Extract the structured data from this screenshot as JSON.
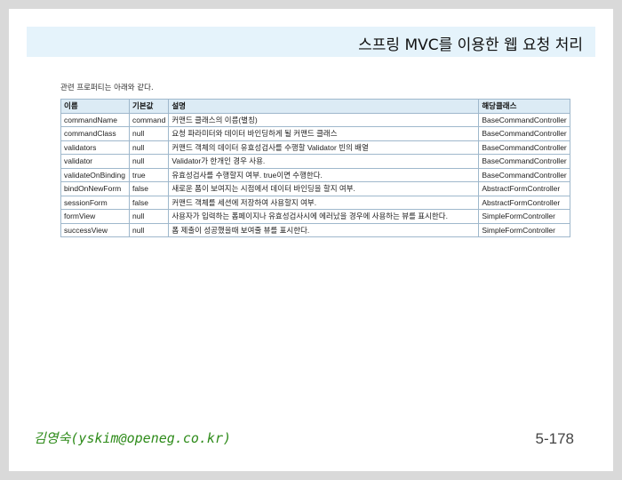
{
  "slide_title": "스프링 MVC를 이용한 웹 요청 처리",
  "intro_text": "관련 프로퍼티는 아래와 같다.",
  "table": {
    "headers": {
      "name": "이름",
      "default": "기본값",
      "desc": "설명",
      "class": "해당클래스"
    },
    "rows": [
      {
        "name": "commandName",
        "default": "command",
        "desc": "커맨드 클래스의 이름(별칭)",
        "class": "BaseCommandController"
      },
      {
        "name": "commandClass",
        "default": "null",
        "desc": "요청 파라미터와 데이터 바인딩하게 될 커맨드 클래스",
        "class": "BaseCommandController"
      },
      {
        "name": "validators",
        "default": "null",
        "desc": "커맨드 객체의 데이터 유효성검사를 수행할 Validator 빈의 배열",
        "class": "BaseCommandController"
      },
      {
        "name": "validator",
        "default": "null",
        "desc": "Validator가 한개인 경우 사용.",
        "class": "BaseCommandController"
      },
      {
        "name": "validateOnBinding",
        "default": "true",
        "desc": "유효성검사를 수행할지 여부. true이면 수행한다.",
        "class": "BaseCommandController"
      },
      {
        "name": "bindOnNewForm",
        "default": "false",
        "desc": "새로운 폼이 보여지는 시점에서 데이터 바인딩을 할지 여부.",
        "class": "AbstractFormController"
      },
      {
        "name": "sessionForm",
        "default": "false",
        "desc": "커맨드 객체를 세션에 저장하여 사용할지 여부.",
        "class": "AbstractFormController"
      },
      {
        "name": "formView",
        "default": "null",
        "desc": "사용자가 입력하는 폼페이지나 유효성검사시에 에러났을 경우에 사용하는 뷰를 표시한다.",
        "class": "SimpleFormController"
      },
      {
        "name": "successView",
        "default": "null",
        "desc": "폼 제출이 성공했을때 보여줄 뷰를 표시한다.",
        "class": "SimpleFormController"
      }
    ]
  },
  "author": "김영숙(yskim@openeg.co.kr)",
  "page_number": "5-178"
}
